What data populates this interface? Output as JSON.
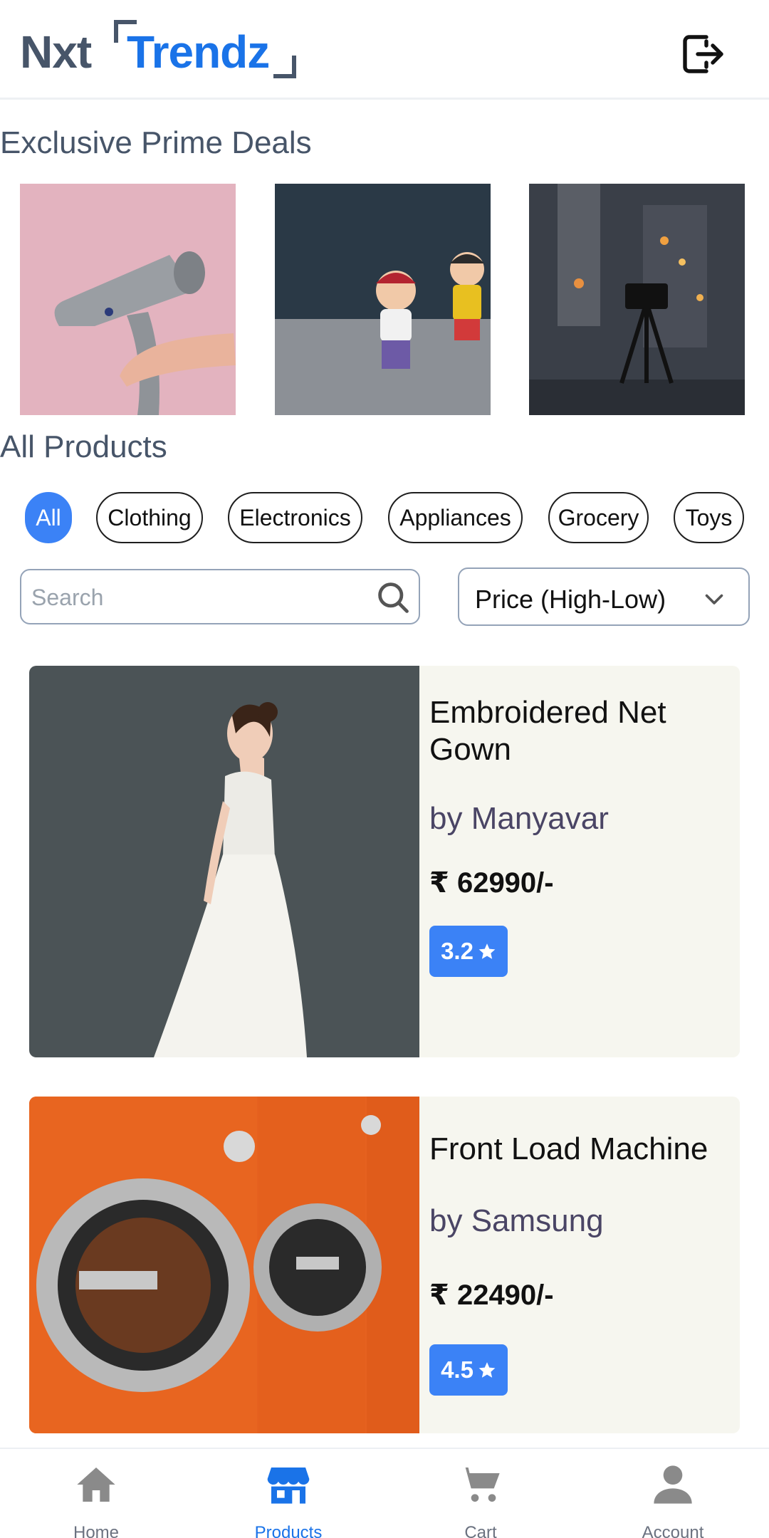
{
  "app": {
    "logo_prefix": "Nxt",
    "logo_brand": "Trendz"
  },
  "header": {
    "logout_icon": "logout-icon"
  },
  "prime_deals": {
    "title": "Exclusive Prime Deals",
    "items": [
      {
        "image": "hair-dryer-photo"
      },
      {
        "image": "toy-figures-photo"
      },
      {
        "image": "camera-tripod-photo"
      }
    ]
  },
  "all_products": {
    "title": "All Products",
    "categories": [
      {
        "label": "All",
        "active": true
      },
      {
        "label": "Clothing",
        "active": false
      },
      {
        "label": "Electronics",
        "active": false
      },
      {
        "label": "Appliances",
        "active": false
      },
      {
        "label": "Grocery",
        "active": false
      },
      {
        "label": "Toys",
        "active": false
      }
    ],
    "search": {
      "placeholder": "Search",
      "value": ""
    },
    "sort": {
      "selected": "Price (High-Low)"
    }
  },
  "products": [
    {
      "title": "Embroidered Net Gown",
      "brand": "by Manyavar",
      "price": "₹ 62990/-",
      "rating": "3.2"
    },
    {
      "title": "Front Load Machine",
      "brand": "by Samsung",
      "price": "₹ 22490/-",
      "rating": "4.5"
    }
  ],
  "bottom_nav": [
    {
      "label": "Home",
      "icon": "home-icon",
      "active": false
    },
    {
      "label": "Products",
      "icon": "store-icon",
      "active": true
    },
    {
      "label": "Cart",
      "icon": "cart-icon",
      "active": false
    },
    {
      "label": "Account",
      "icon": "account-icon",
      "active": false
    }
  ],
  "colors": {
    "accent": "#3b82f6",
    "brand": "#1a73e8",
    "heading": "#475569",
    "card": "#f6f6ef",
    "brand_text": "#4a4565"
  }
}
